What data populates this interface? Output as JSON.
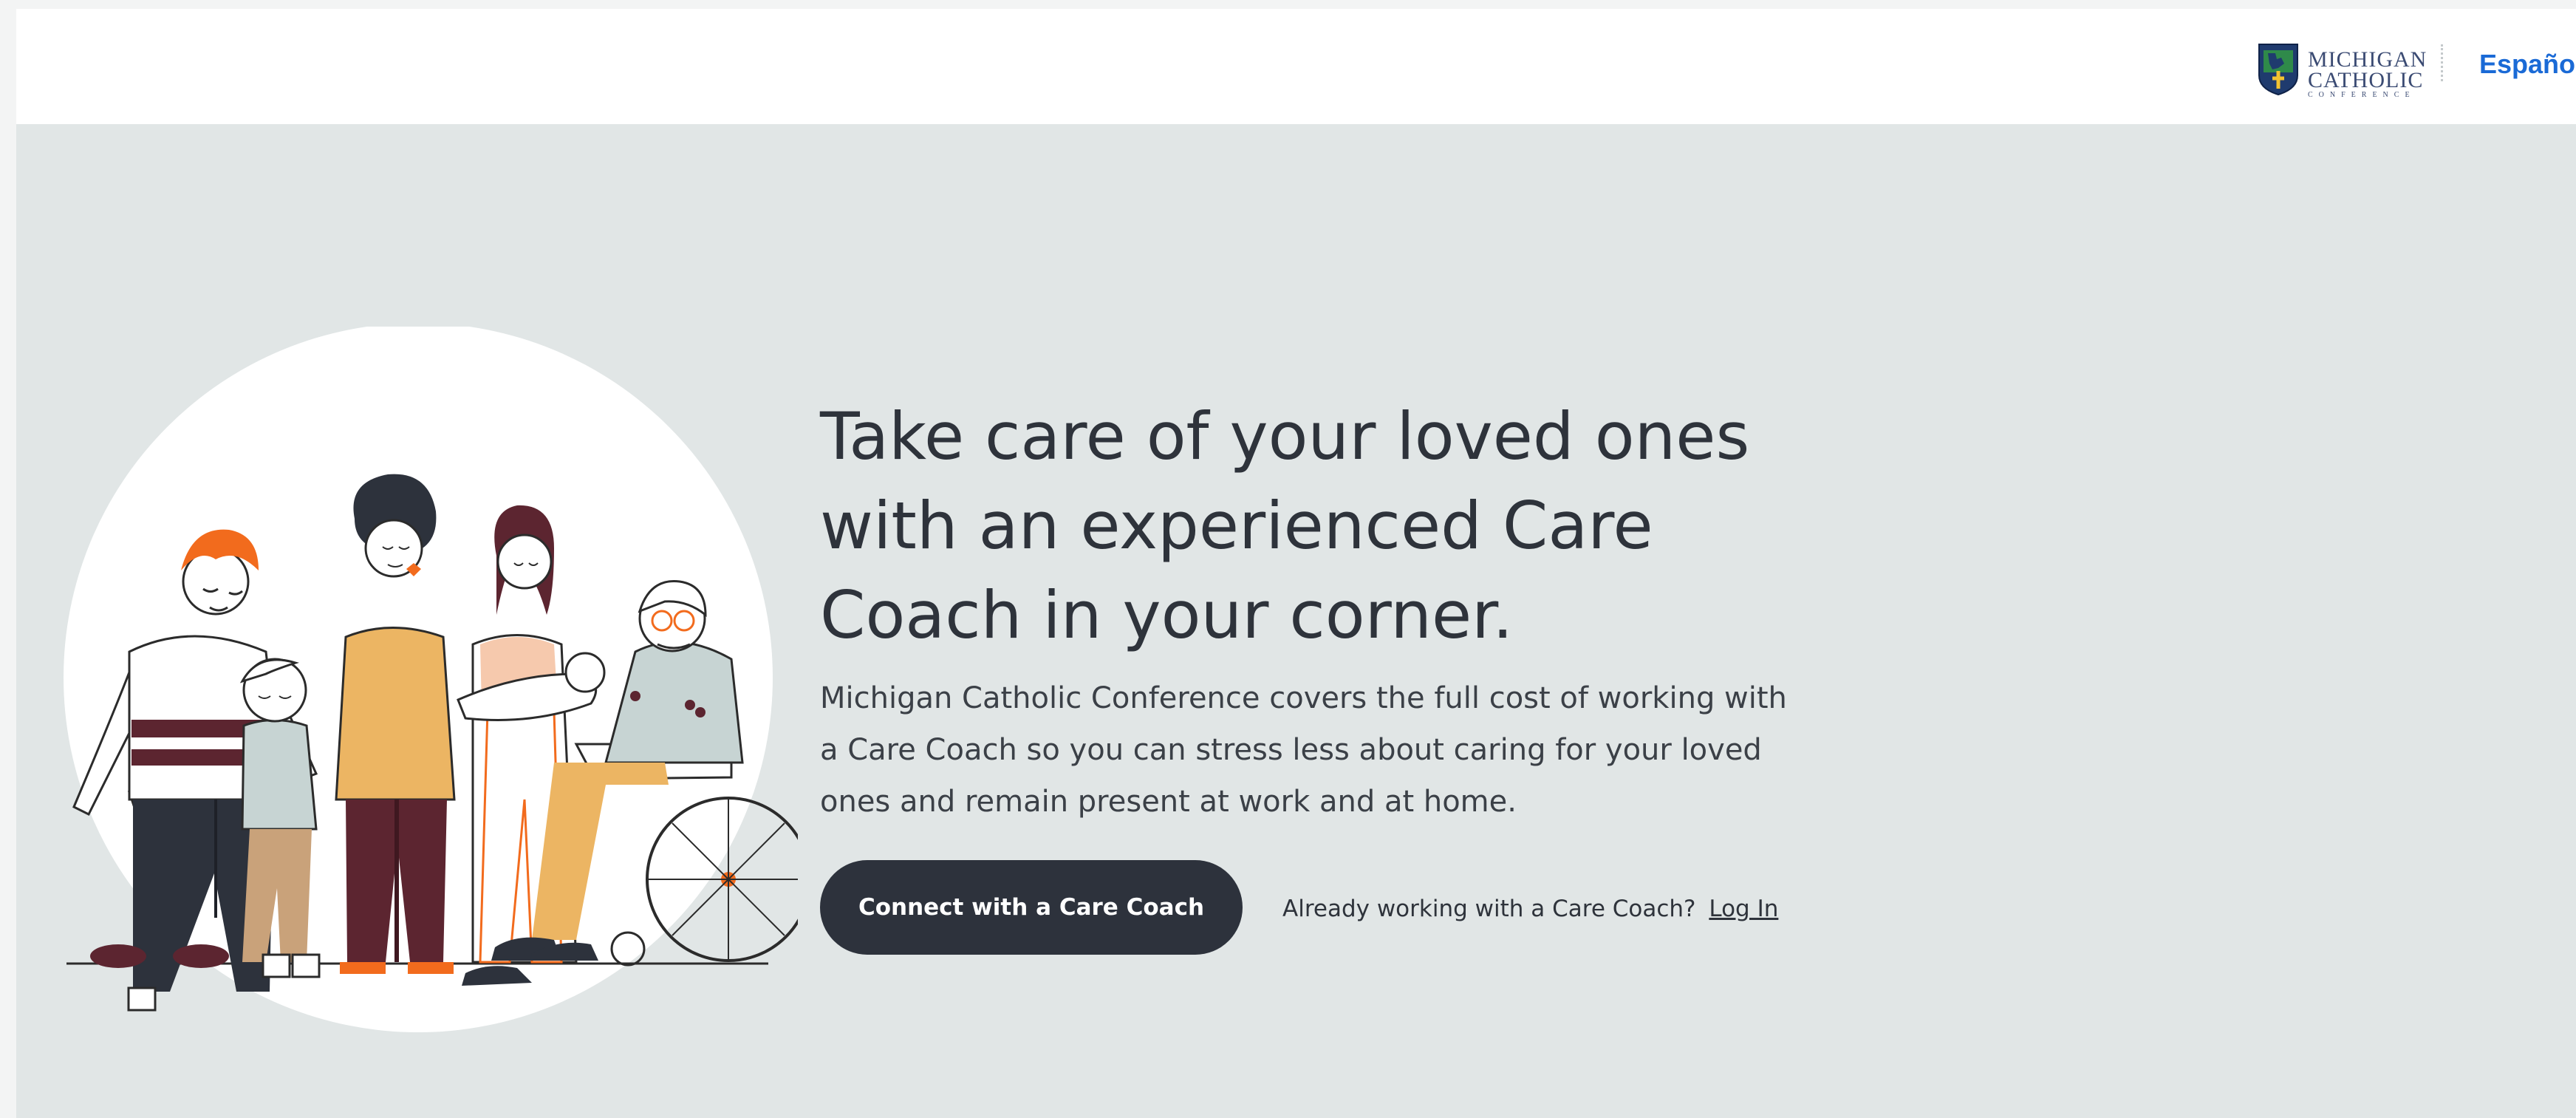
{
  "header": {
    "logo": {
      "line1": "MICHIGAN",
      "line2": "CATHOLIC",
      "line3": "CONFERENCE",
      "icon": "michigan-catholic-conference-crest"
    },
    "language_link": "Español"
  },
  "hero": {
    "headline": "Take care of your loved ones with an experienced Care Coach in your corner.",
    "subtext": "Michigan Catholic Conference covers the full cost of working with a Care Coach so you can stress less about caring for your loved ones and remain present at work and at home.",
    "cta_label": "Connect with a Care Coach",
    "already_text": "Already working with a Care Coach?",
    "login_label": "Log In",
    "illustration": "family-group-illustration"
  },
  "colors": {
    "page_bg": "#e1e6e6",
    "header_bg": "#ffffff",
    "text_dark": "#2e333b",
    "cta_bg": "#2d323c",
    "link_blue": "#1a6ad6",
    "accent_orange": "#f26b1d",
    "mustard": "#ecb563",
    "maroon": "#5c2530",
    "peach": "#f6c9ad",
    "sage": "#c7d4d3"
  }
}
